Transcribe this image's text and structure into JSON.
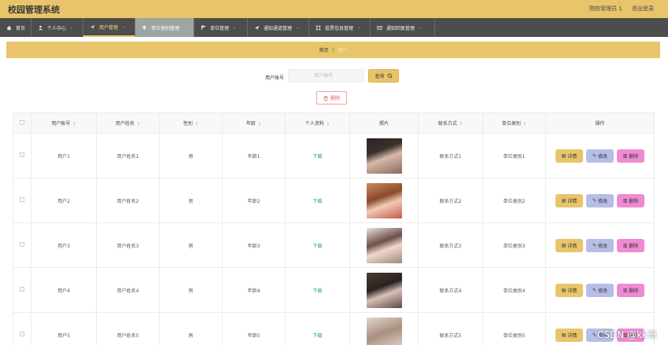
{
  "app": {
    "title": "校园管理系统"
  },
  "top_right": {
    "user": "院校管理员 1",
    "logout": "退出登录"
  },
  "nav": [
    {
      "label": "首页",
      "icon": "home-icon"
    },
    {
      "label": "个人中心",
      "icon": "user-icon"
    },
    {
      "label": "用户管理",
      "icon": "send-icon"
    },
    {
      "label": "单位类别管理",
      "icon": "pin-icon"
    },
    {
      "label": "单位管理",
      "icon": "flag-icon"
    },
    {
      "label": "通知通道管理",
      "icon": "send-icon"
    },
    {
      "label": "投票信息管理",
      "icon": "grid-icon"
    },
    {
      "label": "通知回复管理",
      "icon": "mail-icon"
    }
  ],
  "breadcrumb": {
    "home": "首页",
    "sep": "/",
    "current": "用户"
  },
  "search": {
    "label": "用户账号",
    "placeholder": "用户账号",
    "button": "查询"
  },
  "toolbar": {
    "delete_label": "删除"
  },
  "table": {
    "columns": [
      "用户账号",
      "用户姓名",
      "性别",
      "年龄",
      "个人资料",
      "照片",
      "联系方式",
      "单位类别",
      "操作"
    ],
    "rows": [
      {
        "account": "用户1",
        "name": "用户姓名1",
        "gender": "男",
        "age": "年龄1",
        "profile": "下载",
        "contact": "联系方式1",
        "category": "单位类别1"
      },
      {
        "account": "用户2",
        "name": "用户姓名2",
        "gender": "男",
        "age": "年龄2",
        "profile": "下载",
        "contact": "联系方式2",
        "category": "单位类别2"
      },
      {
        "account": "用户3",
        "name": "用户姓名3",
        "gender": "男",
        "age": "年龄3",
        "profile": "下载",
        "contact": "联系方式3",
        "category": "单位类别3"
      },
      {
        "account": "用户4",
        "name": "用户姓名4",
        "gender": "男",
        "age": "年龄4",
        "profile": "下载",
        "contact": "联系方式4",
        "category": "单位类别4"
      },
      {
        "account": "用户5",
        "name": "用户姓名5",
        "gender": "男",
        "age": "年龄5",
        "profile": "下载",
        "contact": "联系方式5",
        "category": "单位类别5"
      }
    ],
    "actions": {
      "detail": "详情",
      "edit": "修改",
      "delete": "删除"
    }
  },
  "watermark": "CSDN @kk哥",
  "colors": {
    "accent": "#e8c46a",
    "nav_bg": "#4d4d4d",
    "edit": "#b6bde6",
    "delete": "#f08ad2"
  }
}
